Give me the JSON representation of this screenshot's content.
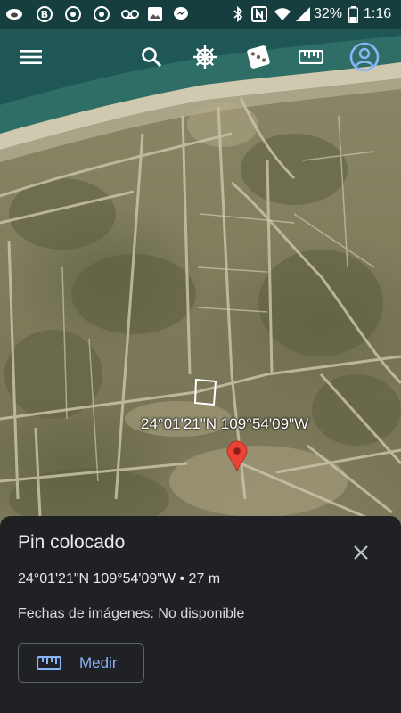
{
  "status_bar": {
    "icons": [
      "cloud-icon",
      "b-app-icon",
      "chrome-icon",
      "chrome-icon",
      "voicemail-icon",
      "image-icon",
      "messenger-icon",
      "bluetooth-icon",
      "nfc-icon",
      "wifi-icon",
      "signal-icon",
      "battery-icon"
    ],
    "battery": "32%",
    "time": "1:16"
  },
  "toolbar": {
    "items": [
      "menu-icon",
      "search-icon",
      "voyager-wheel-icon",
      "dice-icon",
      "ruler-icon",
      "account-icon"
    ]
  },
  "map": {
    "coordinate_label": "24°01'21\"N 109°54'09\"W",
    "pin_color": "#ea4335"
  },
  "sheet": {
    "title": "Pin colocado",
    "coords": "24°01'21\"N 109°54'09\"W • 27 m",
    "imagery": "Fechas de imágenes: No disponible",
    "measure_label": "Medir"
  },
  "colors": {
    "sheet_bg": "#202124",
    "accent": "#8ab4f8",
    "pin": "#ea4335"
  }
}
